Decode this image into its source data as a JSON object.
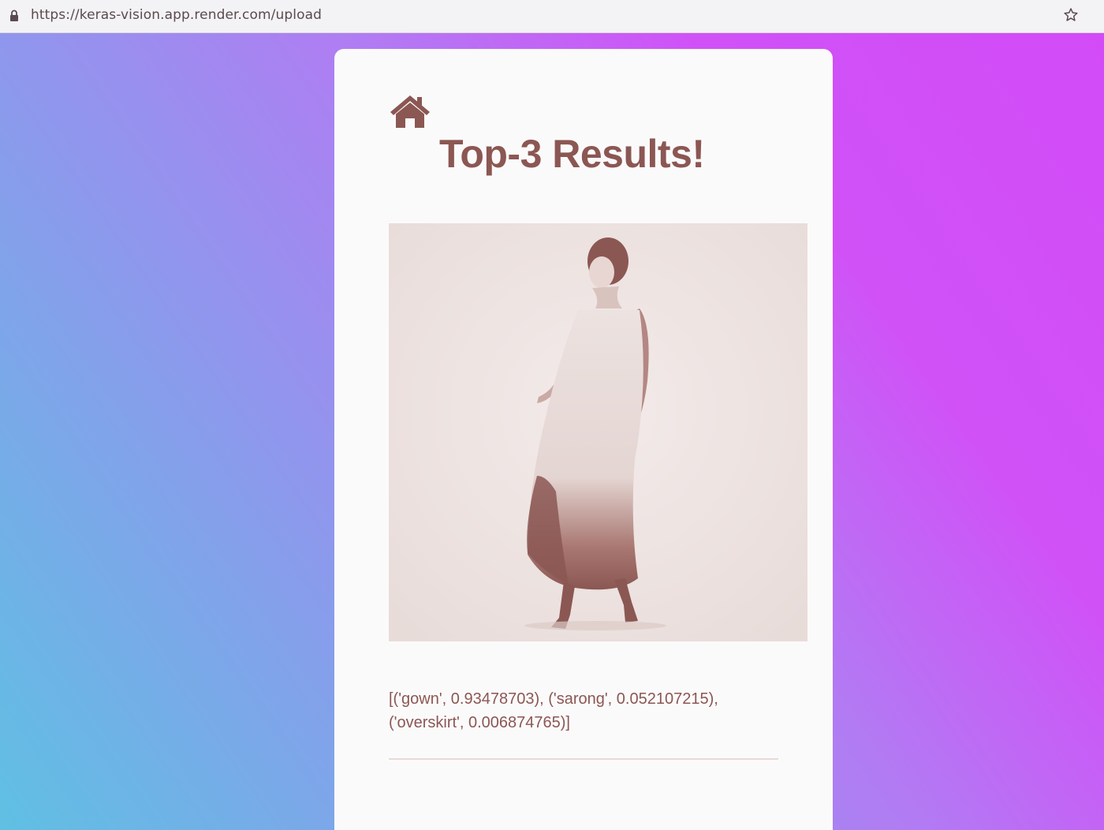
{
  "browser": {
    "url": "https://keras-vision.app.render.com/upload",
    "icons": {
      "lock": "lock-icon",
      "bookmark": "star-icon"
    }
  },
  "page": {
    "home_icon": "home-icon",
    "title": "Top-3 Results!",
    "result_text": "[('gown', 0.93478703), ('sarong', 0.052107215), ('overskirt', 0.006874765)]",
    "colors": {
      "accent": "#8b5753",
      "card": "#fbfafb",
      "gradient_start": "#5fc0e3",
      "gradient_end": "#d24bf7"
    }
  }
}
